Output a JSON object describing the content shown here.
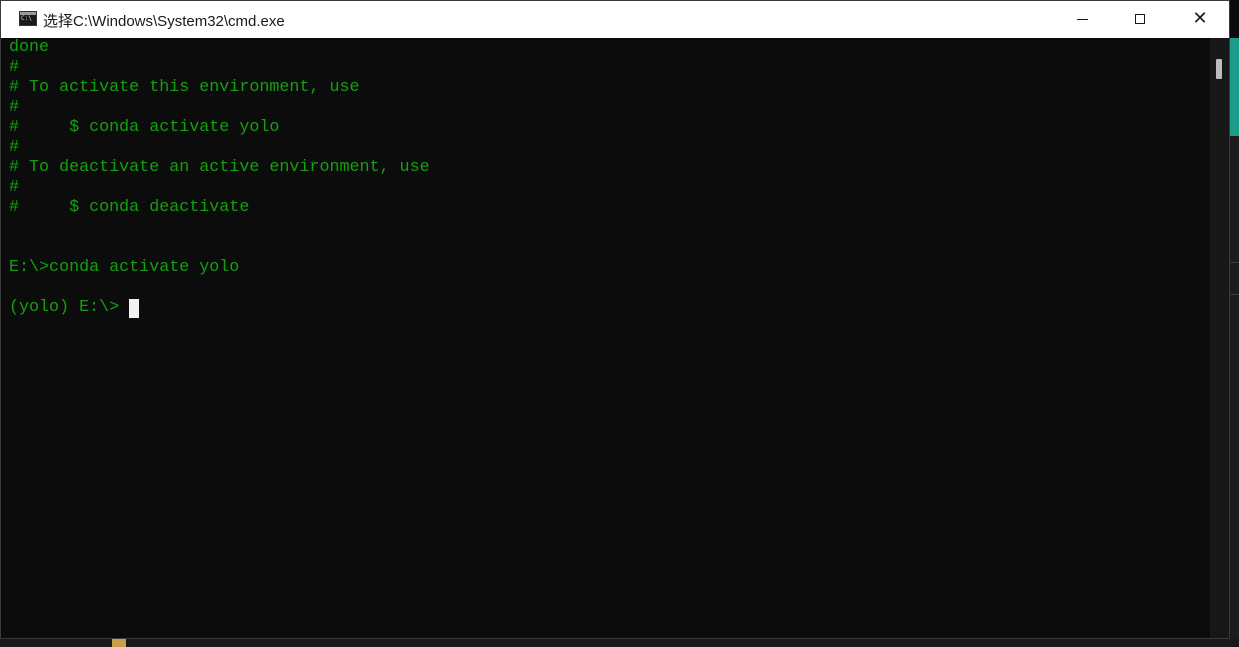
{
  "window": {
    "title": "选择C:\\Windows\\System32\\cmd.exe",
    "icon": "cmd-icon"
  },
  "controls": {
    "minimize": "minimize-icon",
    "maximize": "maximize-icon",
    "close": "close-icon"
  },
  "colors": {
    "console_text": "#13a10e",
    "console_bg": "#0c0c0c",
    "titlebar_bg": "#ffffff"
  },
  "console": {
    "lines": [
      "done",
      "#",
      "# To activate this environment, use",
      "#",
      "#     $ conda activate yolo",
      "#",
      "# To deactivate an active environment, use",
      "#",
      "#     $ conda deactivate",
      "",
      "",
      "E:\\>conda activate yolo",
      "",
      "(yolo) E:\\>"
    ]
  }
}
